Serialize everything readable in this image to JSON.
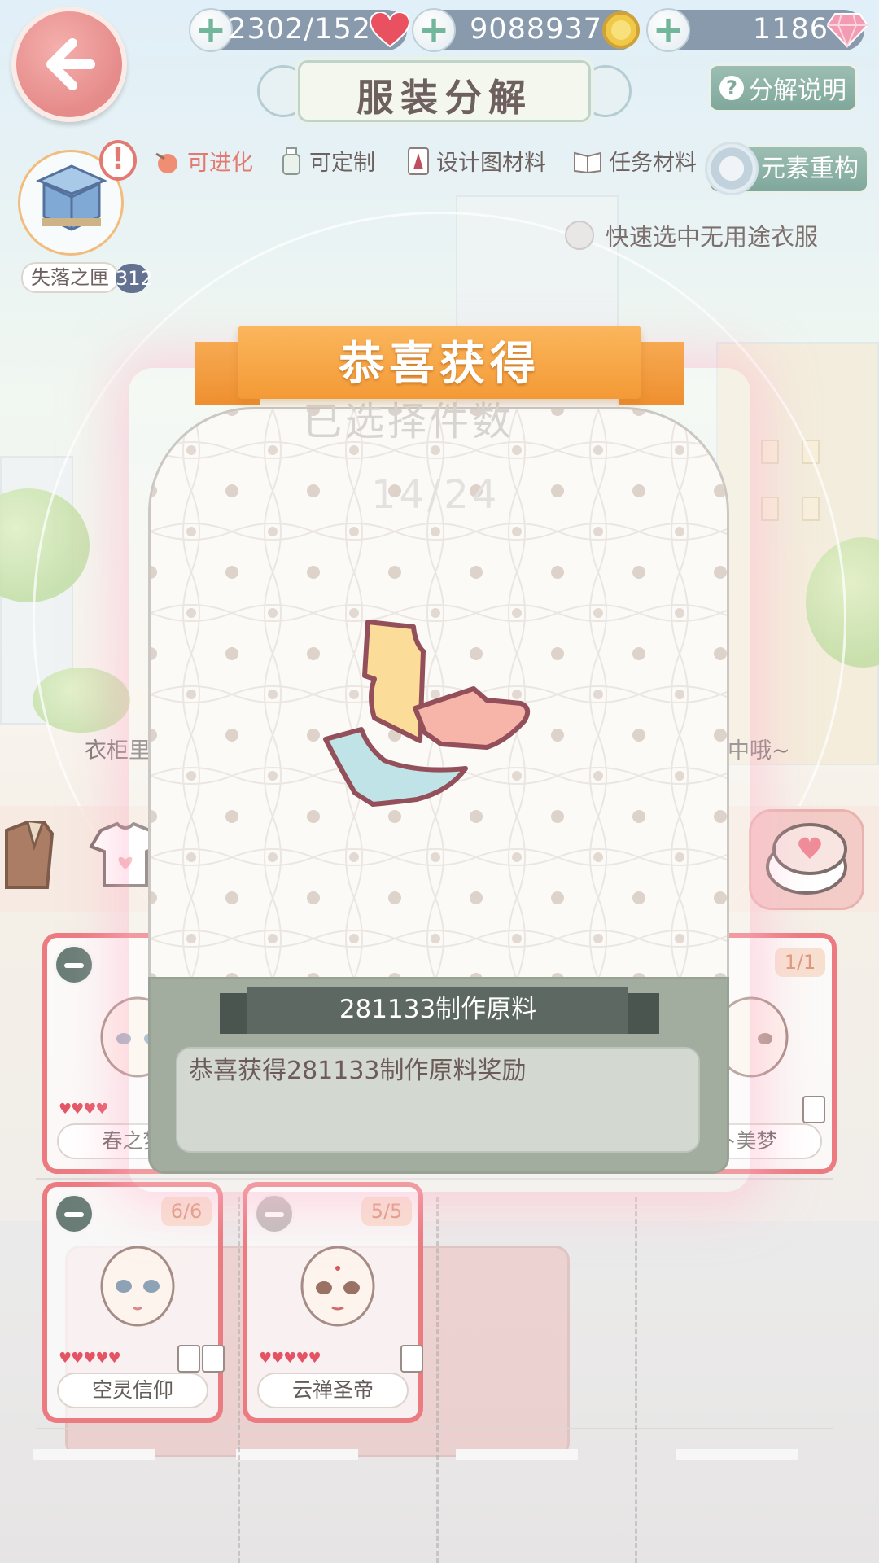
{
  "top_bar": {
    "stamina": "2302/152",
    "gold": "9088937",
    "diamonds": "1186",
    "title": "服装分解",
    "help_label": "分解说明",
    "help_glyph": "?"
  },
  "filters": [
    {
      "label": "可进化"
    },
    {
      "label": "可定制"
    },
    {
      "label": "设计图材料"
    },
    {
      "label": "任务材料"
    }
  ],
  "element_button": "元素重构",
  "box": {
    "label": "失落之匣",
    "count": "312",
    "alert": "!"
  },
  "quick_select": "快速选中无用途衣服",
  "background_hint": {
    "left": "衣柜里",
    "right": "中哦~"
  },
  "modal": {
    "banner": "恭喜获得",
    "faded_title": "已选择件数",
    "faded_count": "14/24",
    "item_name": "281133制作原料",
    "message": "恭喜获得281133制作原料奖励"
  },
  "cards": [
    {
      "name": "春之梦",
      "count": "",
      "hearts": "♥♥♥♥"
    },
    {
      "name": "卜美梦",
      "count": "1/1",
      "hearts": ""
    },
    {
      "name": "空灵信仰",
      "count": "6/6",
      "hearts": "♥♥♥♥♥"
    },
    {
      "name": "云禅圣帝",
      "count": "5/5",
      "hearts": "♥♥♥♥♥"
    }
  ],
  "colors": {
    "accent_red": "#ea6870",
    "banner_orange": "#f39a36",
    "modal_base": "#a2ad9f",
    "button_green": "#6f9c8e"
  }
}
